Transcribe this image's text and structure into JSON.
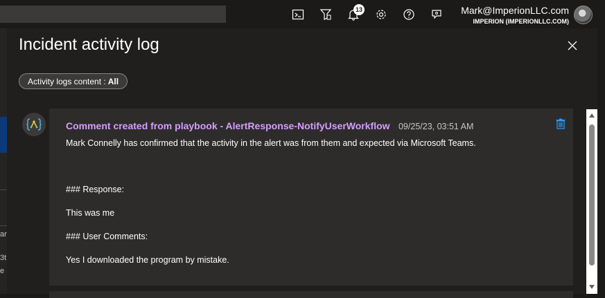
{
  "topbar": {
    "icons": [
      "cloud-shell-icon",
      "directory-filter-icon",
      "notifications-icon",
      "settings-icon",
      "help-icon",
      "feedback-icon"
    ],
    "notification_count": "13",
    "account_email": "Mark@ImperionLLC.com",
    "account_tenant": "IMPERION (IMPERIONLLC.COM)"
  },
  "panel": {
    "title": "Incident activity log",
    "filter_label": "Activity logs content :",
    "filter_value": "All"
  },
  "comment": {
    "title": "Comment created from playbook - AlertResponse-NotifyUserWorkflow",
    "timestamp": "09/25/23, 03:51 AM",
    "lines": [
      "Mark Connelly has confirmed that the activity in the alert was from them and expected via Microsoft Teams.",
      "### Response:",
      "This was me",
      "### User Comments:",
      "Yes I downloaded the program by mistake."
    ]
  },
  "background_fragments": [
    "ar",
    "3t",
    "e"
  ],
  "colors": {
    "accent_purple": "#d59dff",
    "trash_blue": "#2899f5",
    "panel_bg": "#201f1e",
    "card_bg": "#2d2c2b"
  }
}
